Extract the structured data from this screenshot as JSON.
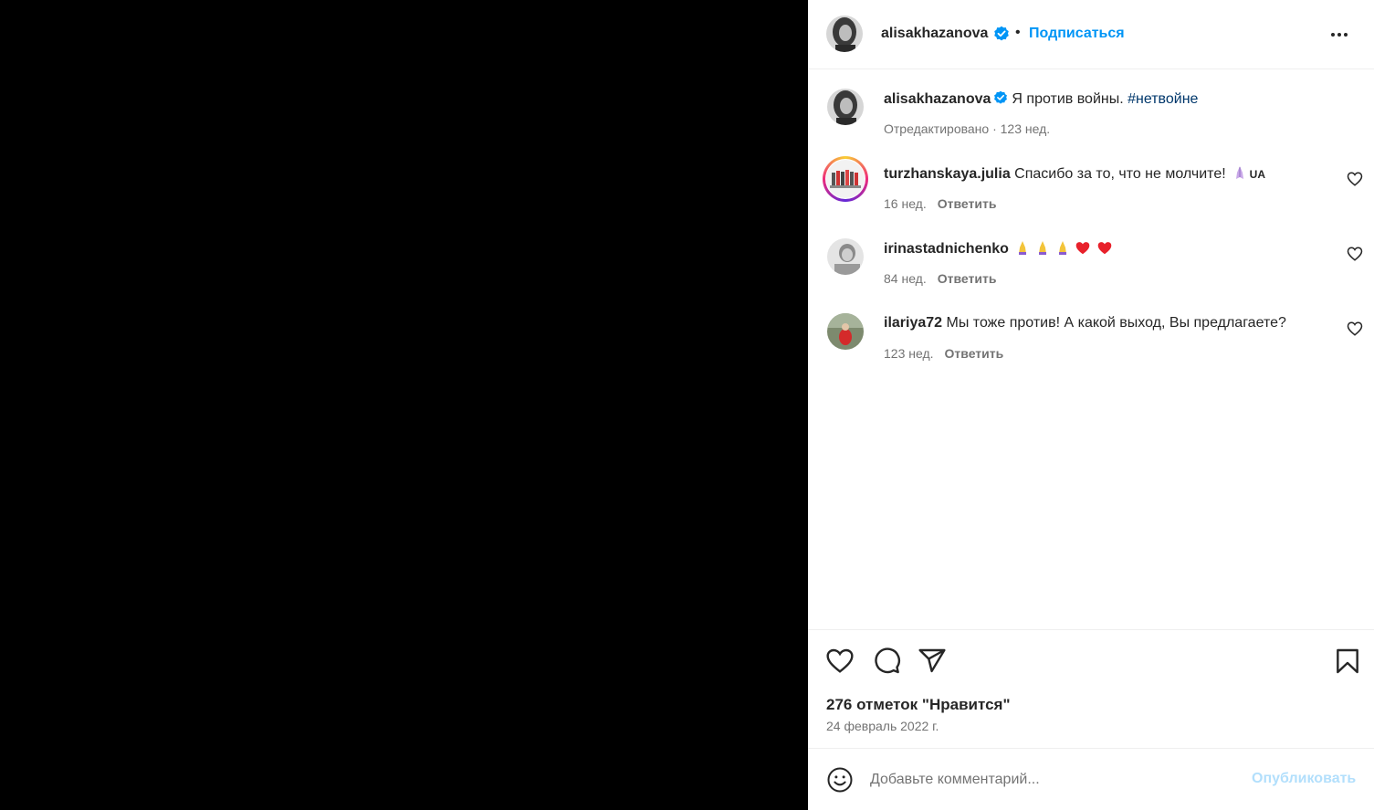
{
  "post": {
    "author": "alisakhazanova",
    "follow_label": "Подписаться",
    "separator": "•",
    "caption_text": "Я против войны.",
    "hashtag": "#нетвойне",
    "caption_meta": "Отредактировано · 123 нед.",
    "likes_text": "276 отметок \"Нравится\"",
    "date": "24 февраль 2022 г."
  },
  "comments": [
    {
      "username": "turzhanskaya.julia",
      "text": "Спасибо за то, что не молчите!",
      "emoji": [
        "folded-hands"
      ],
      "badge": "UA",
      "time": "16 нед.",
      "reply_label": "Ответить"
    },
    {
      "username": "irinastadnichenko",
      "text": "",
      "emoji": [
        "folded-hands",
        "folded-hands",
        "folded-hands",
        "red-heart",
        "red-heart"
      ],
      "time": "84 нед.",
      "reply_label": "Ответить"
    },
    {
      "username": "ilariya72",
      "text": "Мы тоже против! А какой выход, Вы предлагаете?",
      "emoji": [],
      "time": "123 нед.",
      "reply_label": "Ответить"
    }
  ],
  "comment_input": {
    "placeholder": "Добавьте комментарий...",
    "publish_label": "Опубликовать"
  },
  "colors": {
    "accent": "#0095f6",
    "hashtag": "#00376b",
    "secondary_text": "#737373",
    "publish_disabled": "#b2dffc",
    "media_bg": "#000000"
  },
  "icons": [
    "verified-badge-icon",
    "more-options-icon",
    "heart-icon",
    "comment-icon",
    "share-icon",
    "bookmark-icon",
    "emoji-icon"
  ]
}
